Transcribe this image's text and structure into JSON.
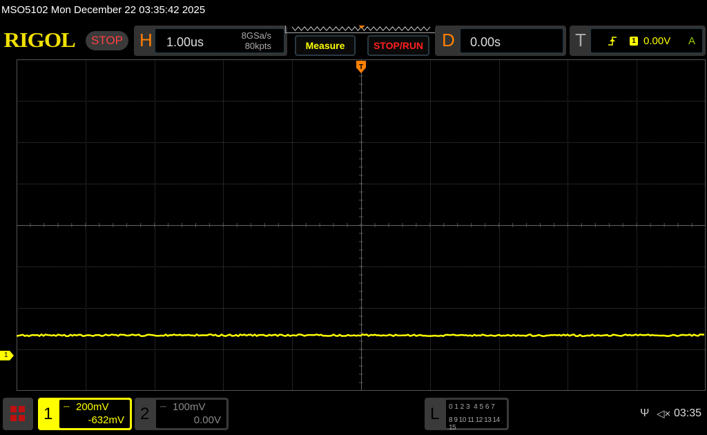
{
  "header": {
    "title": "MSO5102  Mon December 22 03:35:42 2025",
    "logo": "RIGOL",
    "run_state": "STOP"
  },
  "horizontal": {
    "label": "H",
    "timebase": "1.00us",
    "sample_rate": "8GSa/s",
    "memory_depth": "80kpts"
  },
  "buttons": {
    "measure": "Measure",
    "stop_run": "STOP/RUN"
  },
  "delay": {
    "label": "D",
    "value": "0.00s"
  },
  "trigger": {
    "label": "T",
    "slope_icon": "rising-edge-icon",
    "source": "1",
    "level": "0.00V",
    "mode": "A"
  },
  "channels": [
    {
      "number": "1",
      "scale": "200mV",
      "offset": "-632mV",
      "color": "#ffff00",
      "coupling_icon": "dc-coupling-icon"
    },
    {
      "number": "2",
      "scale": "100mV",
      "offset": "0.00V",
      "color": "#888888",
      "coupling_icon": "dc-coupling-icon"
    }
  ],
  "logic": {
    "label": "L",
    "row1": "0 1 2 3  4 5 6 7",
    "row2": "8 9 10 11 12 13 14 15"
  },
  "status": {
    "usb_icon": "usb-icon",
    "sound_icon": "speaker-muted-icon",
    "time": "03:35"
  },
  "waveform": {
    "ch1_marker": "1",
    "trace_color": "#ffff00",
    "grid": {
      "h_divisions": 10,
      "v_divisions": 8
    }
  }
}
